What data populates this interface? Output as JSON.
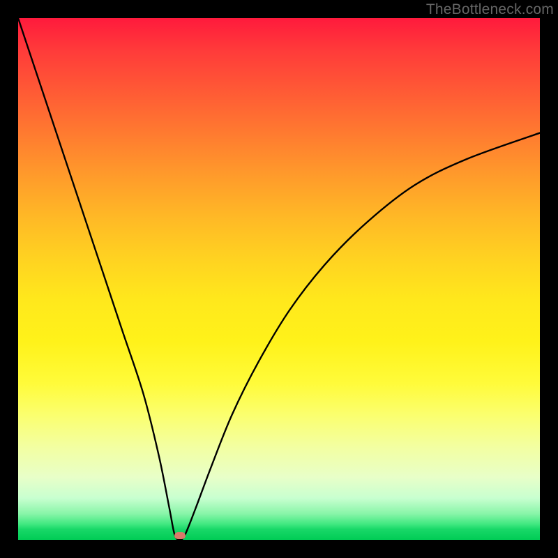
{
  "watermark": "TheBottleneck.com",
  "chart_data": {
    "type": "line",
    "title": "",
    "xlabel": "",
    "ylabel": "",
    "xlim": [
      0,
      100
    ],
    "ylim": [
      0,
      100
    ],
    "series": [
      {
        "name": "bottleneck-curve",
        "x": [
          0,
          4,
          8,
          12,
          16,
          20,
          24,
          27,
          29,
          30,
          31,
          32,
          34,
          37,
          41,
          46,
          52,
          59,
          67,
          76,
          86,
          100
        ],
        "values": [
          100,
          88,
          76,
          64,
          52,
          40,
          28,
          16,
          6,
          1,
          0,
          1,
          6,
          14,
          24,
          34,
          44,
          53,
          61,
          68,
          73,
          78
        ]
      }
    ],
    "annotations": [
      {
        "name": "minimum-marker",
        "x": 31,
        "y": 0.8,
        "color": "#d97a6a"
      }
    ],
    "background": {
      "type": "gradient",
      "direction": "vertical",
      "stops": [
        {
          "pos": 0,
          "color": "#ff1a3c"
        },
        {
          "pos": 50,
          "color": "#ffe81c"
        },
        {
          "pos": 100,
          "color": "#00cc55"
        }
      ]
    }
  }
}
